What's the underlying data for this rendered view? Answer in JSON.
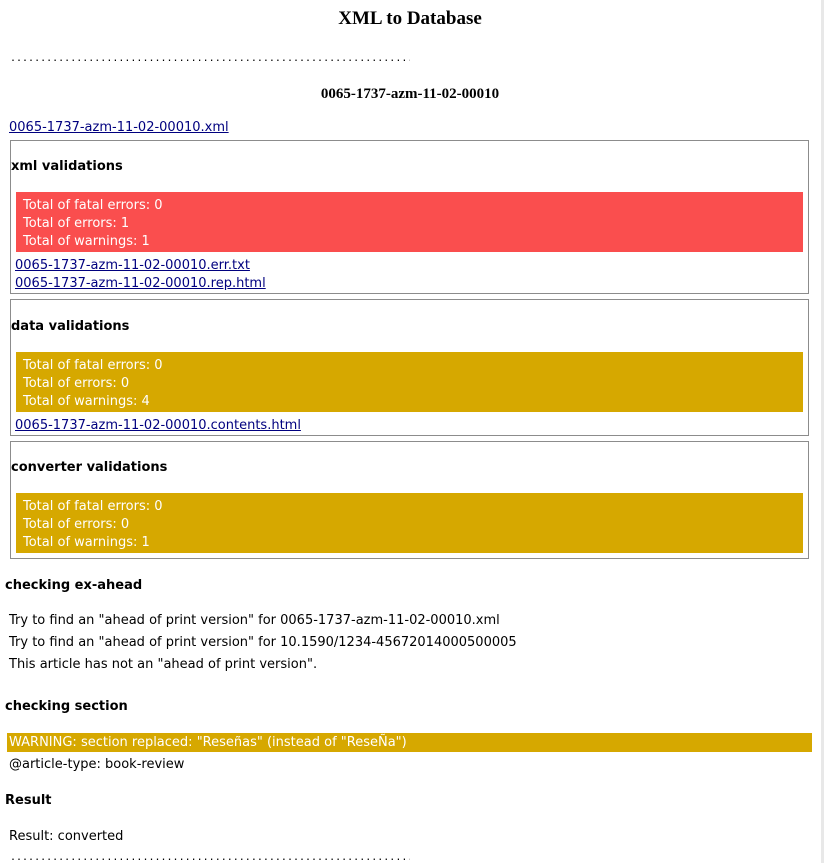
{
  "page": {
    "title": "XML to Database",
    "dots": "................................................................................",
    "doc_title": "0065-1737-azm-11-02-00010",
    "xml_link": "0065-1737-azm-11-02-00010.xml"
  },
  "xml_validations": {
    "title": "xml validations",
    "color": "#fa4e4e",
    "lines": [
      "Total of fatal errors: 0",
      "Total of errors: 1",
      "Total of warnings: 1"
    ],
    "links": [
      "0065-1737-azm-11-02-00010.err.txt",
      "0065-1737-azm-11-02-00010.rep.html"
    ]
  },
  "data_validations": {
    "title": "data validations",
    "color": "#d6a800",
    "lines": [
      "Total of fatal errors: 0",
      "Total of errors: 0",
      "Total of warnings: 4"
    ],
    "links": [
      "0065-1737-azm-11-02-00010.contents.html"
    ]
  },
  "converter_validations": {
    "title": "converter validations",
    "color": "#d6a800",
    "lines": [
      "Total of fatal errors: 0",
      "Total of errors: 0",
      "Total of warnings: 1"
    ]
  },
  "ex_ahead": {
    "title": "checking ex-ahead",
    "lines": [
      "Try to find an \"ahead of print version\" for 0065-1737-azm-11-02-00010.xml",
      "Try to find an \"ahead of print version\" for 10.1590/1234-45672014000500005",
      "This article has not an \"ahead of print version\"."
    ]
  },
  "section": {
    "title": "checking section",
    "warning": "WARNING: section replaced: \"Reseñas\" (instead of \"ReseÑa\")",
    "article_type": "@article-type: book-review"
  },
  "result": {
    "title": "Result",
    "text": "Result: converted"
  }
}
